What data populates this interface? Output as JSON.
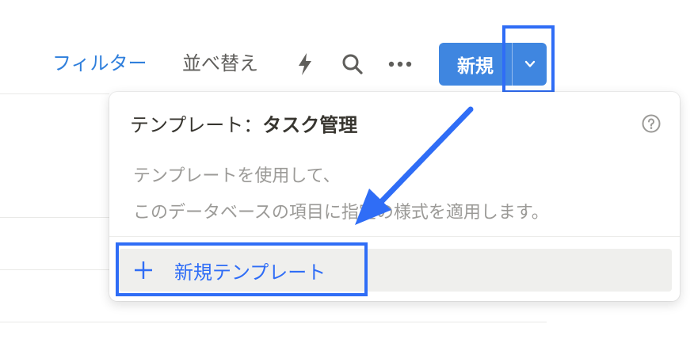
{
  "toolbar": {
    "filter_label": "フィルター",
    "sort_label": "並べ替え",
    "automation_icon": "lightning-icon",
    "search_icon": "search-icon",
    "more_icon": "more-horizontal-icon",
    "new_label": "新規",
    "dropdown_icon": "chevron-down-icon",
    "accent_color": "#3f86e0",
    "filter_color": "#2f7fdc"
  },
  "popup": {
    "title_prefix": "テンプレート：",
    "title_name": "タスク管理",
    "help_icon": "help-circle-icon",
    "description_line1": "テンプレートを使用して、",
    "description_line2": "このデータベースの項目に指定の様式を適用します。",
    "new_template_label": "新規テンプレート",
    "new_template_color": "#2f6df6"
  },
  "annotation": {
    "highlight_color": "#2f6df6"
  }
}
